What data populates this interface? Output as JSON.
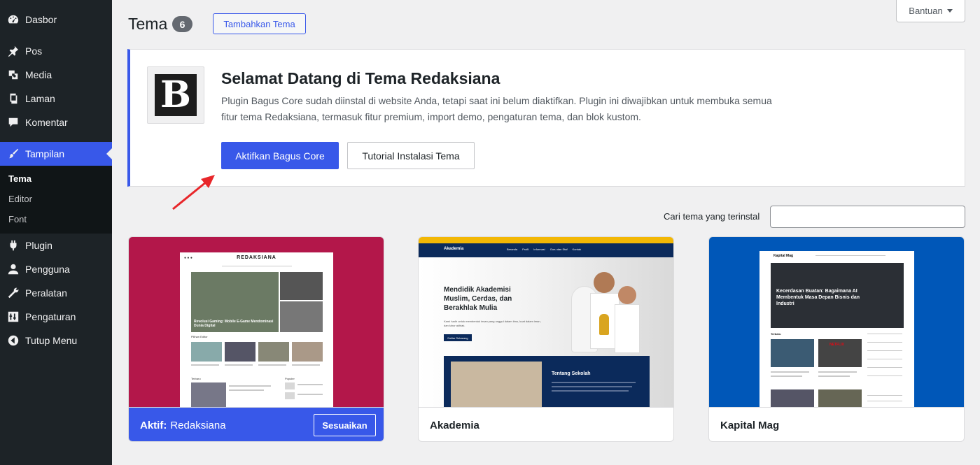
{
  "sidebar": {
    "items": [
      {
        "label": "Dasbor",
        "icon": "dashboard-icon"
      },
      {
        "label": "Pos",
        "icon": "pin-icon"
      },
      {
        "label": "Media",
        "icon": "media-icon"
      },
      {
        "label": "Laman",
        "icon": "page-icon"
      },
      {
        "label": "Komentar",
        "icon": "comment-icon"
      },
      {
        "label": "Tampilan",
        "icon": "brush-icon"
      },
      {
        "label": "Plugin",
        "icon": "plugin-icon"
      },
      {
        "label": "Pengguna",
        "icon": "user-icon"
      },
      {
        "label": "Peralatan",
        "icon": "wrench-icon"
      },
      {
        "label": "Pengaturan",
        "icon": "settings-icon"
      },
      {
        "label": "Tutup Menu",
        "icon": "collapse-icon"
      }
    ],
    "submenu": [
      "Tema",
      "Editor",
      "Font"
    ]
  },
  "header": {
    "title": "Tema",
    "count": "6",
    "add_button": "Tambahkan Tema",
    "help": "Bantuan"
  },
  "notice": {
    "logo_letter": "B",
    "title": "Selamat Datang di Tema Redaksiana",
    "text": "Plugin Bagus Core sudah diinstal di website Anda, tetapi saat ini belum diaktifkan. Plugin ini diwajibkan untuk membuka semua fitur tema Redaksiana, termasuk fitur premium, import demo, pengaturan tema, dan blok kustom.",
    "primary_button": "Aktifkan Bagus Core",
    "secondary_button": "Tutorial Instalasi Tema"
  },
  "search": {
    "label": "Cari tema yang terinstal",
    "value": ""
  },
  "themes": {
    "active": {
      "prefix": "Aktif:",
      "name": "Redaksiana",
      "customize": "Sesuaikan",
      "preview": {
        "logo": "REDAKSIANA",
        "headline": "Revolusi Gaming: Mobile E-Game Mendominasi Dunia Digital",
        "section1": "Pilihan Editor",
        "section2": "Terbaru",
        "section3": "Populer"
      }
    },
    "second": {
      "name": "Akademia",
      "preview": {
        "brand": "Akademia",
        "nav": [
          "Beranda",
          "Profil",
          "Informasi",
          "Guru dan Staf",
          "Kontak"
        ],
        "hero": "Mendidik Akademisi Muslim, Cerdas, dan Berakhlak Mulia",
        "hero_sub": "Kami hadir untuk membentuk insan yang unggul dalam ilmu, kuat dalam iman, dan luhur akhlak.",
        "cta": "Daftar Sekarang",
        "about": "Tentang Sekolah"
      }
    },
    "third": {
      "name": "Kapital Mag",
      "preview": {
        "brand": "Kapital Mag",
        "headline": "Kecerdasan Buatan: Bagaimana AI Membentuk Masa Depan Bisnis dan Industri",
        "section": "Terbaru",
        "badge": "NETFLIX"
      }
    }
  },
  "colors": {
    "accent": "#3858e9",
    "sidebar_bg": "#1d2327",
    "redaksiana_bg": "#b3174a",
    "kapital_bg": "#0057b8",
    "akademia_navy": "#0b2a5b",
    "akademia_yellow": "#f2b705",
    "arrow": "#e8262a"
  }
}
